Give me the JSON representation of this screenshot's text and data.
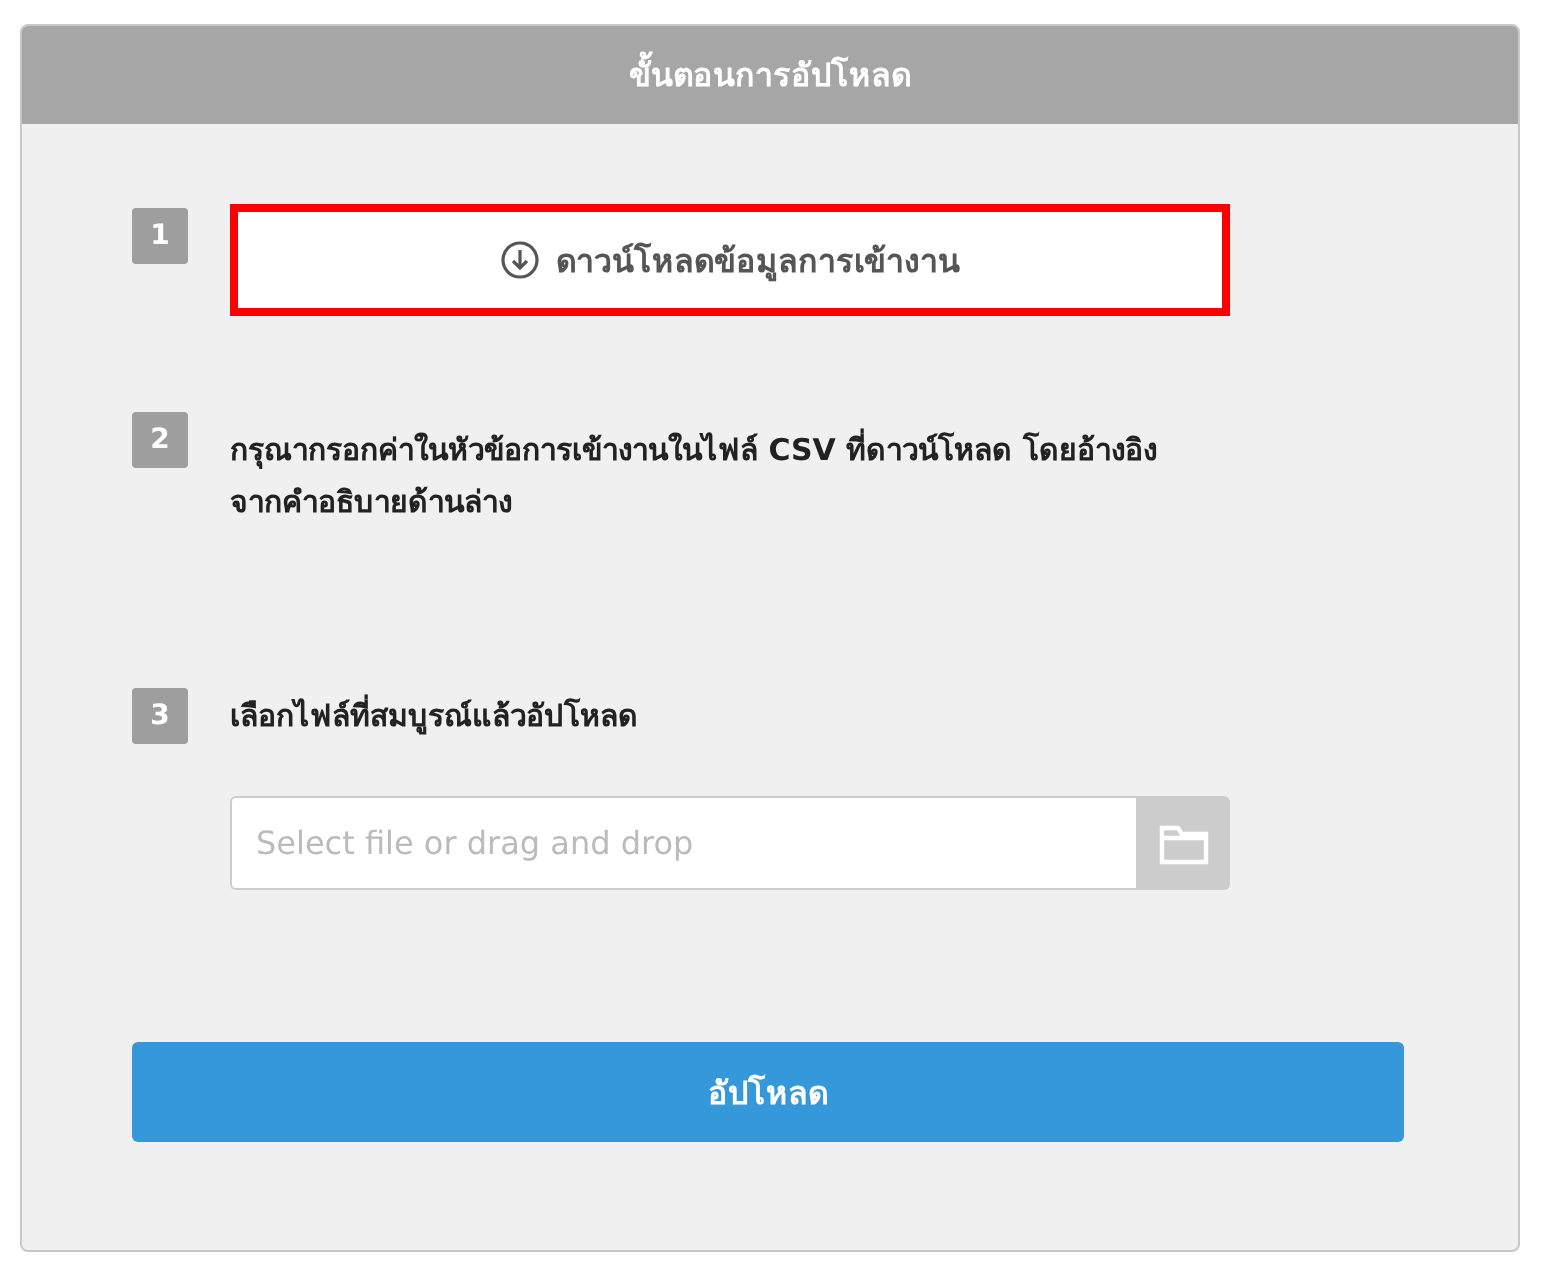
{
  "panel": {
    "title": "ขั้นตอนการอัปโหลด"
  },
  "steps": [
    {
      "kind": "button",
      "number": "1",
      "label": "ดาวน์โหลดข้อมูลการเข้างาน",
      "highlighted": true
    },
    {
      "kind": "text",
      "number": "2",
      "text": "กรุณากรอกค่าในหัวข้อการเข้างานในไฟล์ CSV ที่ดาวน์โหลด โดยอ้างอิงจากคำอธิบายด้านล่าง"
    },
    {
      "kind": "file",
      "number": "3",
      "text": "เลือกไฟล์ที่สมบูรณ์แล้วอัปโหลด",
      "placeholder": "Select file or drag and drop"
    }
  ],
  "submit": {
    "label": "อัปโหลด"
  }
}
